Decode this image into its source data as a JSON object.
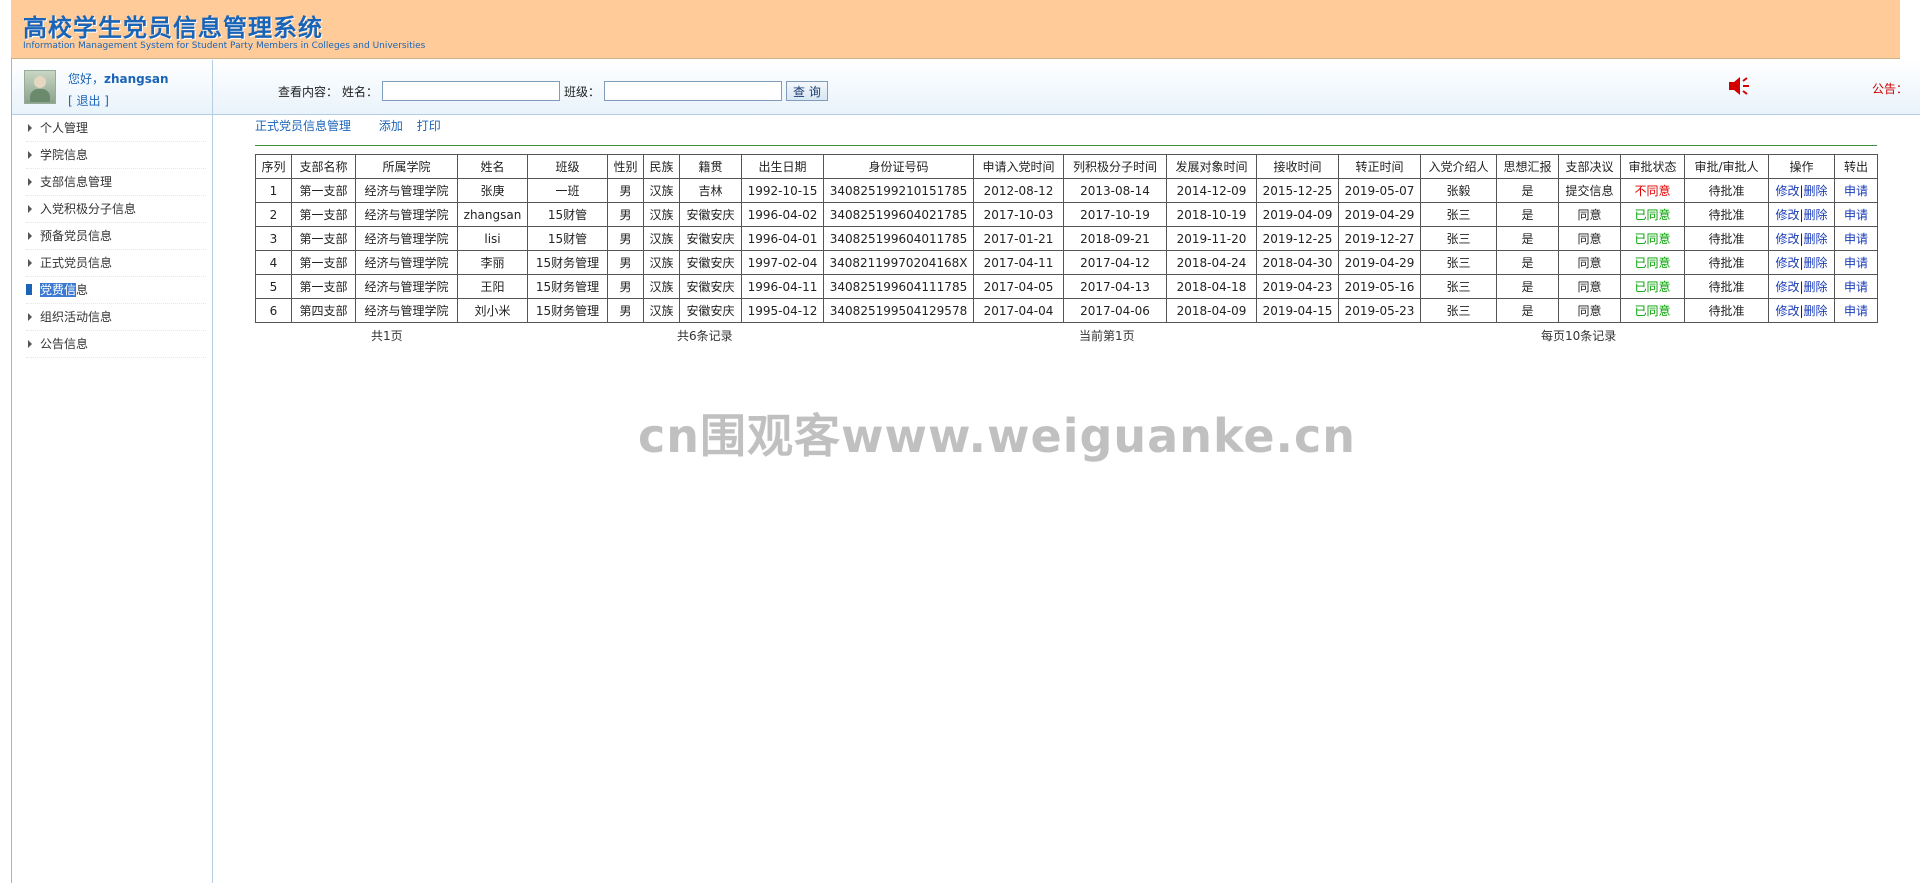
{
  "banner": {
    "title": "高校学生党员信息管理系统",
    "subtitle": "Information Management System for Student Party Members in Colleges and Universities"
  },
  "user": {
    "greeting": "您好，",
    "name": "zhangsan",
    "logout": "[ 退出 ]"
  },
  "search": {
    "prefix": "查看内容：",
    "name_label": "姓名：",
    "name_value": "",
    "class_label": "班级：",
    "class_value": "",
    "button": "查 询"
  },
  "notice_label": "公告：",
  "sidebar": {
    "items": [
      {
        "label": "个人管理"
      },
      {
        "label": "学院信息"
      },
      {
        "label": "支部信息管理"
      },
      {
        "label": "入党积极分子信息"
      },
      {
        "label": "预备党员信息"
      },
      {
        "label": "正式党员信息"
      },
      {
        "label_highlight": "党费信",
        "label_rest": "息"
      },
      {
        "label": "组织活动信息"
      },
      {
        "label": "公告信息"
      }
    ]
  },
  "toolbar": {
    "title": "正式党员信息管理",
    "add": "添加",
    "print": "打印"
  },
  "table": {
    "headers": [
      "序列",
      "支部名称",
      "所属学院",
      "姓名",
      "班级",
      "性别",
      "民族",
      "籍贯",
      "出生日期",
      "身份证号码",
      "申请入党时间",
      "列积极分子时间",
      "发展对象时间",
      "接收时间",
      "转正时间",
      "入党介绍人",
      "思想汇报",
      "支部决议",
      "审批状态",
      "审批/审批人",
      "操作",
      "转出"
    ],
    "rows": [
      [
        "1",
        "第一支部",
        "经济与管理学院",
        "张庚",
        "一班",
        "男",
        "汉族",
        "吉林",
        "1992-10-15",
        "340825199210151785",
        "2012-08-12",
        "2013-08-14",
        "2014-12-09",
        "2015-12-25",
        "2019-05-07",
        "张毅",
        "是",
        "提交信息",
        "不同意",
        "待批准",
        "修改|删除",
        "申请"
      ],
      [
        "2",
        "第一支部",
        "经济与管理学院",
        "zhangsan",
        "15财管",
        "男",
        "汉族",
        "安徽安庆",
        "1996-04-02",
        "340825199604021785",
        "2017-10-03",
        "2017-10-19",
        "2018-10-19",
        "2019-04-09",
        "2019-04-29",
        "张三",
        "是",
        "同意",
        "已同意",
        "待批准",
        "修改|删除",
        "申请"
      ],
      [
        "3",
        "第一支部",
        "经济与管理学院",
        "lisi",
        "15财管",
        "男",
        "汉族",
        "安徽安庆",
        "1996-04-01",
        "340825199604011785",
        "2017-01-21",
        "2018-09-21",
        "2019-11-20",
        "2019-12-25",
        "2019-12-27",
        "张三",
        "是",
        "同意",
        "已同意",
        "待批准",
        "修改|删除",
        "申请"
      ],
      [
        "4",
        "第一支部",
        "经济与管理学院",
        "李丽",
        "15财务管理",
        "男",
        "汉族",
        "安徽安庆",
        "1997-02-04",
        "34082119970204168X",
        "2017-04-11",
        "2017-04-12",
        "2018-04-24",
        "2018-04-30",
        "2019-04-29",
        "张三",
        "是",
        "同意",
        "已同意",
        "待批准",
        "修改|删除",
        "申请"
      ],
      [
        "5",
        "第一支部",
        "经济与管理学院",
        "王阳",
        "15财务管理",
        "男",
        "汉族",
        "安徽安庆",
        "1996-04-11",
        "340825199604111785",
        "2017-04-05",
        "2017-04-13",
        "2018-04-18",
        "2019-04-23",
        "2019-05-16",
        "张三",
        "是",
        "同意",
        "已同意",
        "待批准",
        "修改|删除",
        "申请"
      ],
      [
        "6",
        "第四支部",
        "经济与管理学院",
        "刘小米",
        "15财务管理",
        "男",
        "汉族",
        "安徽安庆",
        "1995-04-12",
        "340825199504129578",
        "2017-04-04",
        "2017-04-06",
        "2018-04-09",
        "2019-04-15",
        "2019-05-23",
        "张三",
        "是",
        "同意",
        "已同意",
        "待批准",
        "修改|删除",
        "申请"
      ]
    ]
  },
  "pager": {
    "total_pages": "共1页",
    "total_records": "共6条记录",
    "current": "当前第1页",
    "per_page": "每页10条记录"
  },
  "watermark": "cn围观客www.weiguanke.cn",
  "colors": {
    "banner": "#ffcc99",
    "link": "#1a64b8",
    "rejected": "#e00000",
    "approved": "#00a000"
  },
  "icons": {
    "speaker": "speaker-icon",
    "avatar": "user-avatar"
  }
}
